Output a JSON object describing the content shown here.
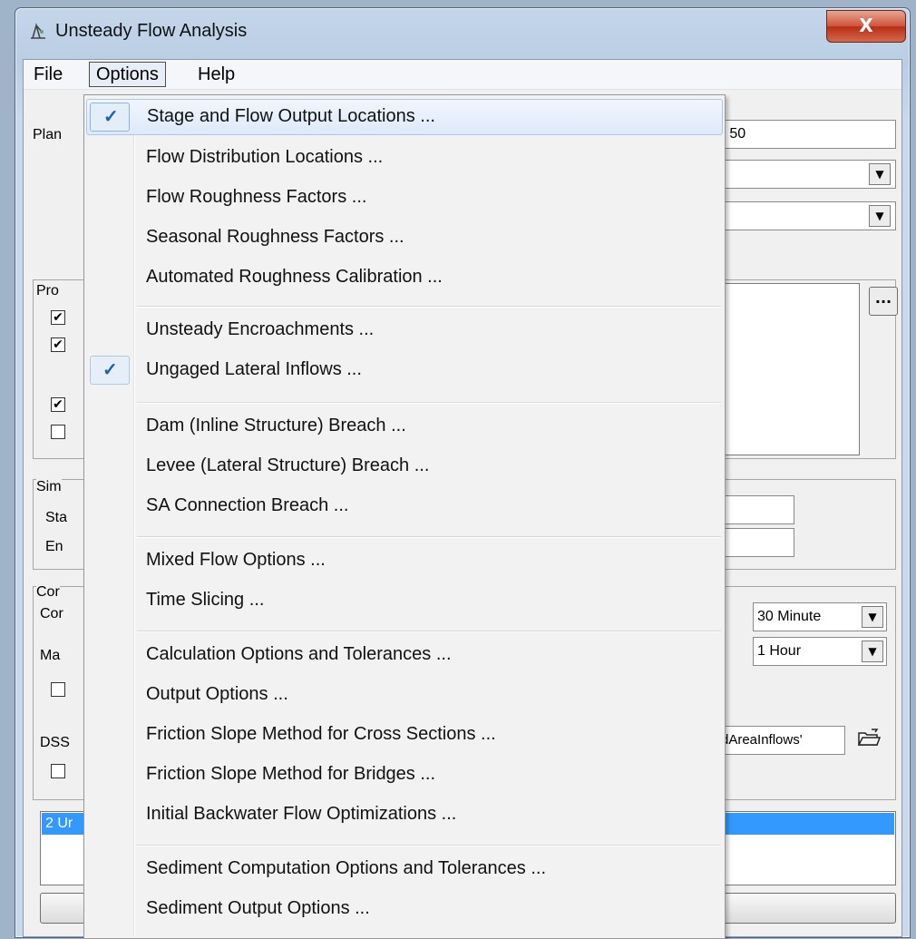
{
  "window": {
    "title": "Unsteady Flow Analysis",
    "close_label": "X"
  },
  "menubar": {
    "file": "File",
    "options": "Options",
    "help": "Help"
  },
  "form": {
    "plan_label": "Plan",
    "plan_value_partial": "d 50",
    "programs_label_partial": "Pro",
    "sim_label_partial": "Sim",
    "start_label_partial": "Sta",
    "end_label_partial": "En",
    "computation_label_partial": "Cor",
    "comp_interval_label_partial": "Cor",
    "mapping_label_partial": "Ma",
    "dss_label_partial": "DSS",
    "comp_interval_value": "30 Minute",
    "mapping_interval_value": "1 Hour",
    "dss_path_partial": "dAreaInflows'",
    "list_row_partial": "2 Ur",
    "dots_label": "...",
    "checkboxes": [
      true,
      true,
      true,
      false,
      false,
      false
    ]
  },
  "options_menu": {
    "items": [
      {
        "label": "Stage and Flow Output Locations ...",
        "checked": true,
        "highlighted": true
      },
      {
        "label": "Flow Distribution Locations ...",
        "checked": false
      },
      {
        "label": "Flow Roughness Factors ...",
        "checked": false
      },
      {
        "label": "Seasonal Roughness Factors ...",
        "checked": false
      },
      {
        "label": "Automated Roughness Calibration ...",
        "checked": false
      },
      {
        "label": "Unsteady Encroachments ...",
        "checked": false
      },
      {
        "label": "Ungaged Lateral Inflows ...",
        "checked": true
      },
      {
        "label": "Dam (Inline Structure) Breach ...",
        "checked": false
      },
      {
        "label": "Levee (Lateral Structure) Breach ...",
        "checked": false
      },
      {
        "label": "SA Connection Breach ...",
        "checked": false
      },
      {
        "label": "Mixed Flow Options ...",
        "checked": false
      },
      {
        "label": "Time Slicing ...",
        "checked": false
      },
      {
        "label": "Calculation Options and Tolerances ...",
        "checked": false
      },
      {
        "label": "Output Options ...",
        "checked": false
      },
      {
        "label": "Friction Slope Method for Cross Sections ...",
        "checked": false
      },
      {
        "label": "Friction Slope Method for Bridges ...",
        "checked": false
      },
      {
        "label": "Initial Backwater Flow Optimizations ...",
        "checked": false
      },
      {
        "label": "Sediment Computation Options and Tolerances ...",
        "checked": false
      },
      {
        "label": "Sediment Output Options ...",
        "checked": false
      }
    ],
    "check_glyph": "✓"
  }
}
